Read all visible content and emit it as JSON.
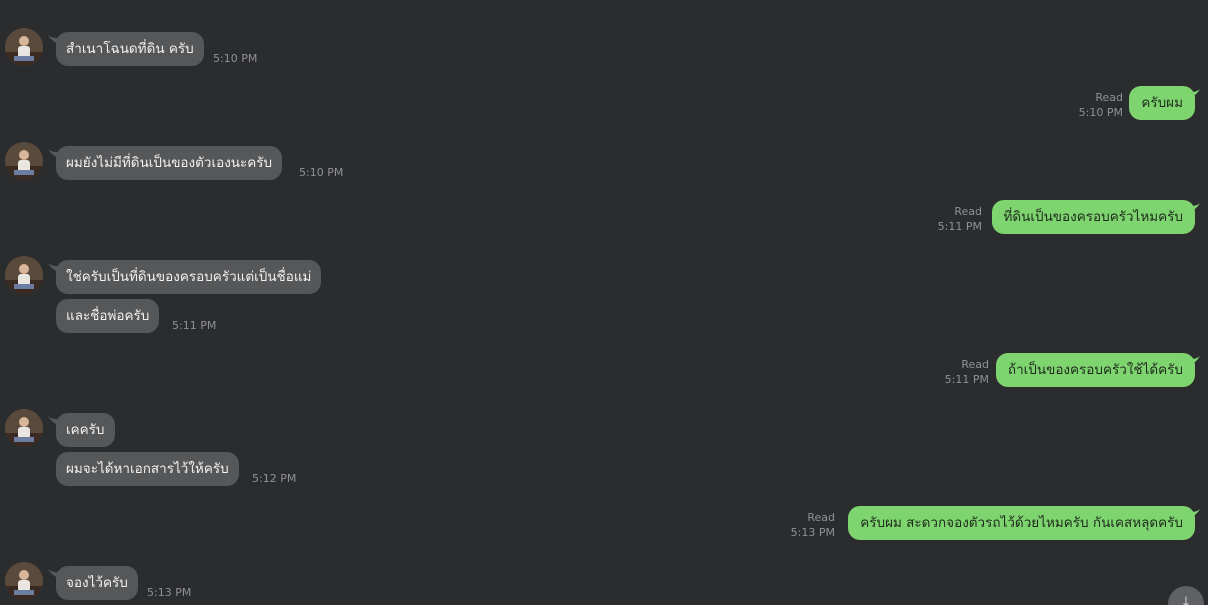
{
  "colors": {
    "background": "#2b2c2e",
    "incoming_bubble": "#565759",
    "outgoing_bubble": "#7ed56f",
    "timestamp": "#8f9194"
  },
  "avatar_icon": "user-photo-avatar",
  "scroll_button_icon": "arrow-down-icon",
  "messages": [
    {
      "direction": "in",
      "text": "สำเนาโฉนดที่ดิน ครับ",
      "time": "5:10 PM"
    },
    {
      "direction": "out",
      "text": "ครับผม",
      "status": "Read",
      "time": "5:10 PM"
    },
    {
      "direction": "in",
      "text": "ผมยังไม่มีที่ดินเป็นของตัวเองนะครับ",
      "time": "5:10 PM"
    },
    {
      "direction": "out",
      "text": "ที่ดินเป็นของครอบครัวไหมครับ",
      "status": "Read",
      "time": "5:11 PM"
    },
    {
      "direction": "in",
      "text": "ใช่ครับเป็นที่ดินของครอบครัวแต่เป็นชื่อแม่"
    },
    {
      "direction": "in",
      "text": "และชื่อพ่อครับ",
      "time": "5:11 PM"
    },
    {
      "direction": "out",
      "text": "ถ้าเป็นของครอบครัวใช้ได้ครับ",
      "status": "Read",
      "time": "5:11 PM"
    },
    {
      "direction": "in",
      "text": "เคครับ"
    },
    {
      "direction": "in",
      "text": "ผมจะได้หาเอกสารไว้ให้ครับ",
      "time": "5:12 PM"
    },
    {
      "direction": "out",
      "text": "ครับผม สะดวกจองตัวรถไว้ด้วยไหมครับ กันเคสหลุดครับ",
      "status": "Read",
      "time": "5:13 PM"
    },
    {
      "direction": "in",
      "text": "จองไว้ครับ",
      "time": "5:13 PM"
    }
  ]
}
